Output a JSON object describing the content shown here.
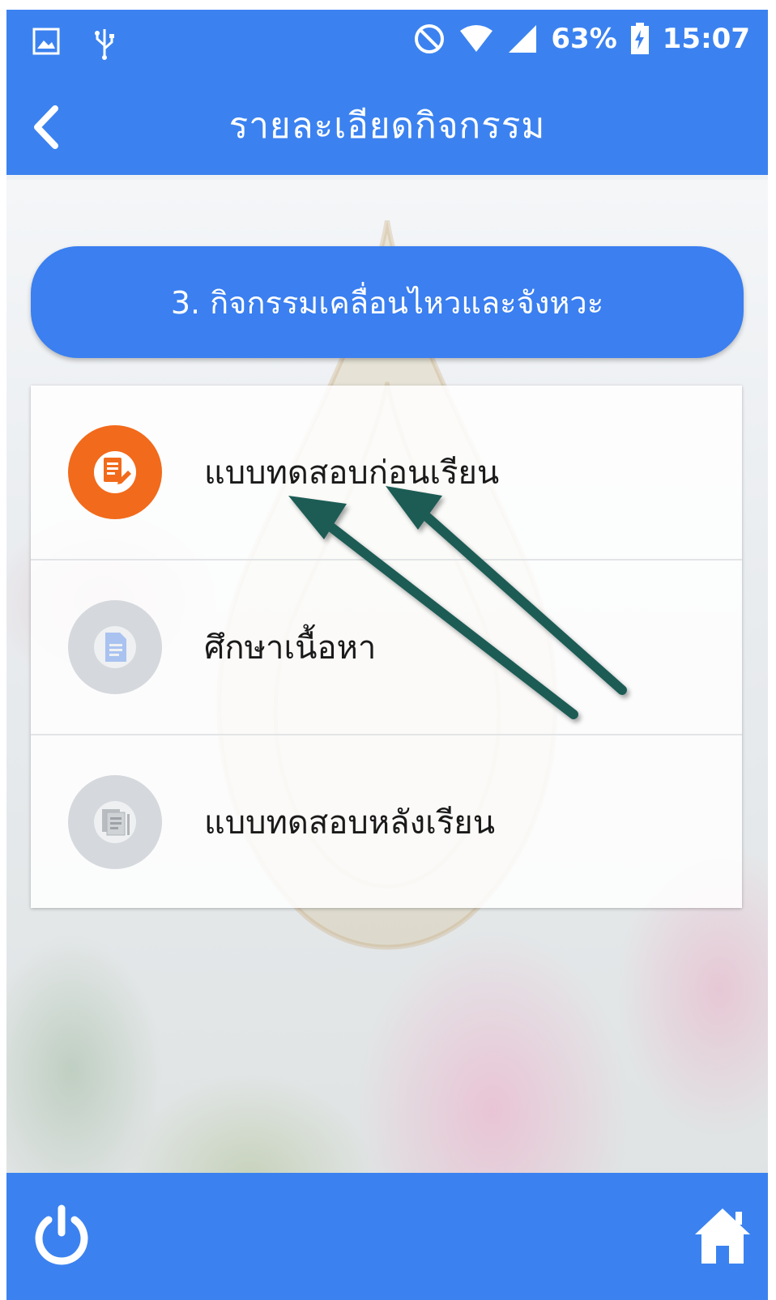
{
  "status_bar": {
    "left_icons": [
      "image-icon",
      "usb-icon"
    ],
    "right_icons": [
      "do-not-disturb-icon",
      "wifi-icon",
      "signal-icon",
      "battery-charging-icon"
    ],
    "battery": "63%",
    "time": "15:07"
  },
  "app_bar": {
    "title": "รายละเอียดกิจกรรม",
    "back_icon": "chevron-left-icon"
  },
  "section": {
    "title": "3. กิจกรรมเคลื่อนไหวและจังหวะ"
  },
  "menu": {
    "items": [
      {
        "label": "แบบทดสอบก่อนเรียน",
        "icon": "pretest-document-icon",
        "state": "active"
      },
      {
        "label": "ศึกษาเนื้อหา",
        "icon": "content-document-icon",
        "state": "disabled"
      },
      {
        "label": "แบบทดสอบหลังเรียน",
        "icon": "posttest-document-icon",
        "state": "disabled"
      }
    ]
  },
  "bottom_bar": {
    "left_icon": "power-icon",
    "right_icon": "home-icon"
  },
  "colors": {
    "primary": "#3b82f0",
    "active_icon": "#f26a1b",
    "disabled_icon": "#d5d8dc",
    "annotation_arrow": "#1f5c55"
  }
}
